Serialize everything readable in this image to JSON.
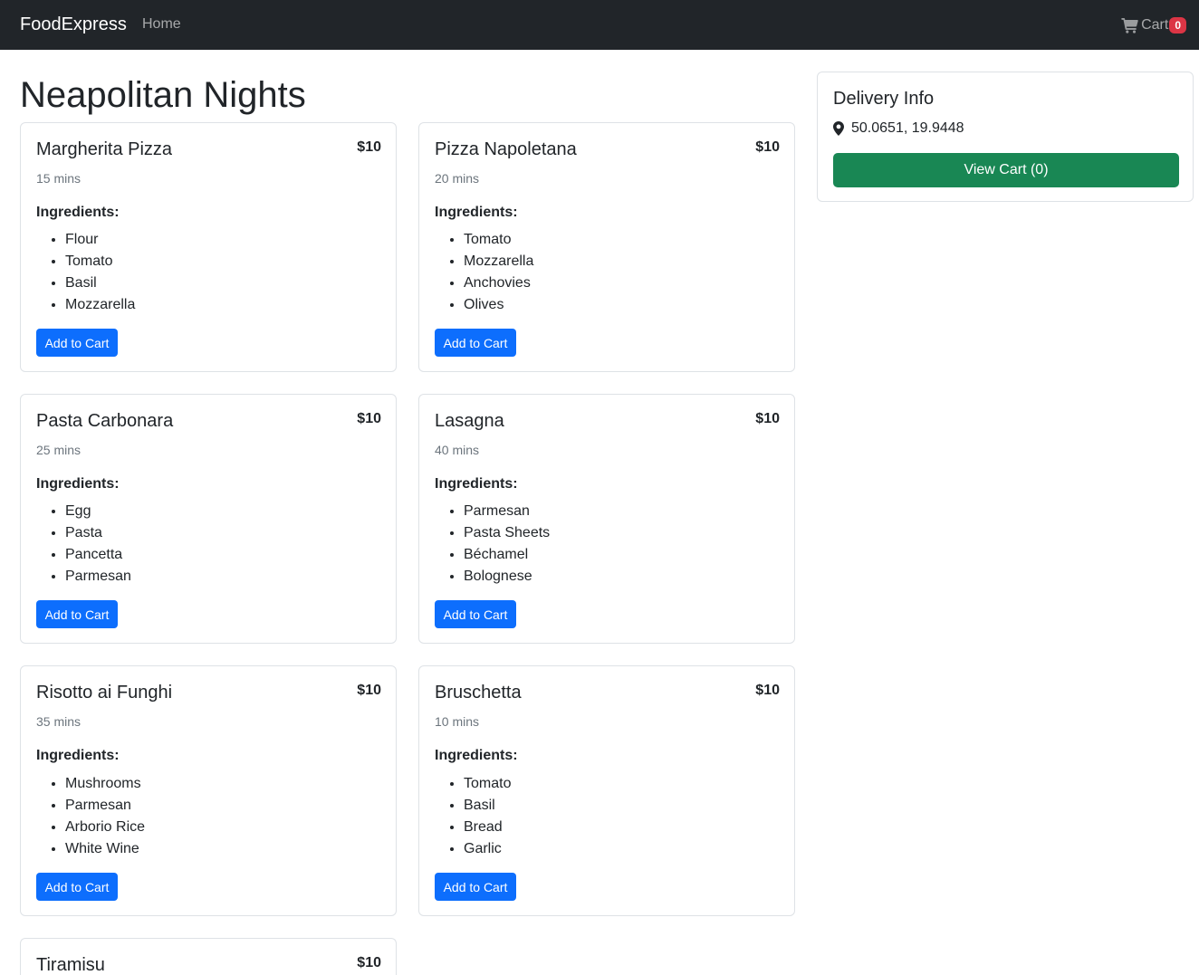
{
  "nav": {
    "brand": "FoodExpress",
    "home": "Home",
    "cart_label": "Cart",
    "cart_count": "0",
    "cart_icon": "shopping-cart-icon"
  },
  "page_title": "Neapolitan Nights",
  "add_to_cart_label": "Add to Cart",
  "ingredients_label": "Ingredients:",
  "dishes": [
    {
      "name": "Margherita Pizza",
      "price": "$10",
      "time": "15 mins",
      "ingredients": [
        "Flour",
        "Tomato",
        "Basil",
        "Mozzarella"
      ]
    },
    {
      "name": "Pizza Napoletana",
      "price": "$10",
      "time": "20 mins",
      "ingredients": [
        "Tomato",
        "Mozzarella",
        "Anchovies",
        "Olives"
      ]
    },
    {
      "name": "Pasta Carbonara",
      "price": "$10",
      "time": "25 mins",
      "ingredients": [
        "Egg",
        "Pasta",
        "Pancetta",
        "Parmesan"
      ]
    },
    {
      "name": "Lasagna",
      "price": "$10",
      "time": "40 mins",
      "ingredients": [
        "Parmesan",
        "Pasta Sheets",
        "Béchamel",
        "Bolognese"
      ]
    },
    {
      "name": "Risotto ai Funghi",
      "price": "$10",
      "time": "35 mins",
      "ingredients": [
        "Mushrooms",
        "Parmesan",
        "Arborio Rice",
        "White Wine"
      ]
    },
    {
      "name": "Bruschetta",
      "price": "$10",
      "time": "10 mins",
      "ingredients": [
        "Tomato",
        "Basil",
        "Bread",
        "Garlic"
      ]
    },
    {
      "name": "Tiramisu",
      "price": "$10"
    }
  ],
  "delivery": {
    "title": "Delivery Info",
    "coords": "50.0651, 19.9448",
    "location_icon": "map-pin-icon",
    "view_cart_label": "View Cart (0)"
  },
  "colors": {
    "navbar": "#212529",
    "primary": "#0d6efd",
    "success": "#198754",
    "badge": "#dc3545"
  }
}
